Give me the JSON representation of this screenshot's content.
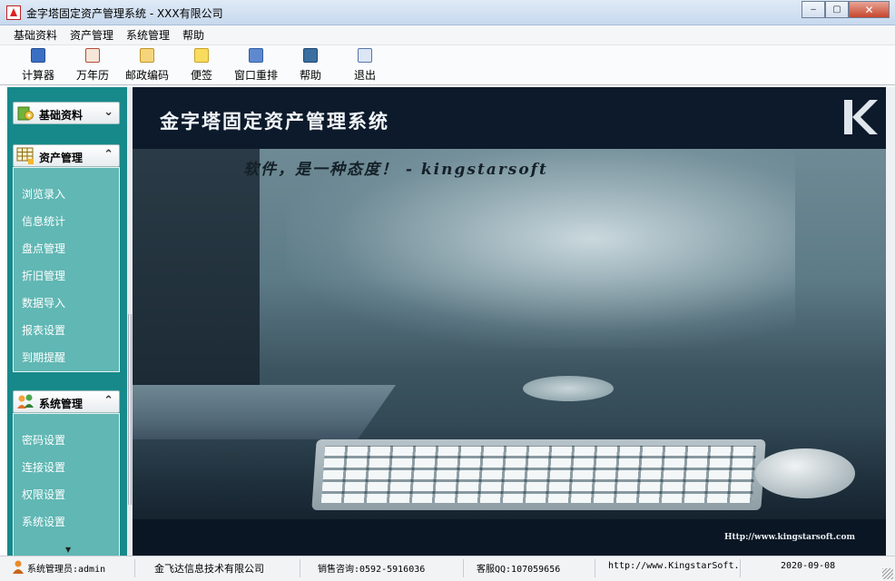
{
  "window": {
    "title": "金字塔固定资产管理系统 - XXX有限公司",
    "controls": {
      "minimize": "‒",
      "maximize": "▢",
      "close": "✕"
    }
  },
  "menu": [
    "基础资料",
    "资产管理",
    "系统管理",
    "帮助"
  ],
  "toolbar": [
    {
      "label": "计算器",
      "icon": "calculator-icon",
      "color": "#3a6fc4"
    },
    {
      "label": "万年历",
      "icon": "calendar-icon",
      "color": "#b54a3a"
    },
    {
      "label": "邮政编码",
      "icon": "postcode-icon",
      "color": "#e3b13c"
    },
    {
      "label": "便签",
      "icon": "note-icon",
      "color": "#f1c232"
    },
    {
      "label": "窗口重排",
      "icon": "window-arrange-icon",
      "color": "#2f5ea8"
    },
    {
      "label": "帮助",
      "icon": "help-book-icon",
      "color": "#3b6fa0"
    },
    {
      "label": "退出",
      "icon": "exit-icon",
      "color": "#5577aa"
    }
  ],
  "sidebar": {
    "sections": [
      {
        "title": "基础资料",
        "icon": "settings-icon",
        "expanded": false,
        "chevron": "⌄",
        "items": []
      },
      {
        "title": "资产管理",
        "icon": "table-grid-icon",
        "expanded": true,
        "chevron": "⌃",
        "items": [
          "浏览录入",
          "信息统计",
          "盘点管理",
          "折旧管理",
          "数据导入",
          "报表设置",
          "到期提醒"
        ]
      },
      {
        "title": "系统管理",
        "icon": "users-icon",
        "expanded": true,
        "chevron": "⌃",
        "items": [
          "密码设置",
          "连接设置",
          "权限设置",
          "系统设置"
        ]
      }
    ],
    "scroll_indicator": "▼"
  },
  "main": {
    "system_title": "金字塔固定资产管理系统",
    "slogan": "软件，是一种态度！ - kingstarsoft",
    "url": "Http://www.kingstarsoft.com",
    "logo": "K"
  },
  "status": {
    "user": "系统管理员:admin",
    "company": "金飞达信息技术有限公司",
    "sales": "销售咨询:0592-5916036",
    "support": "客服QQ:107059656",
    "website": "http://www.KingstarSoft.",
    "date": "2020-09-08"
  },
  "colors": {
    "sidebar_bg": "#17898a",
    "sidebar_panel": "#60b7b4",
    "banner_bg": "#0c1a2b"
  }
}
